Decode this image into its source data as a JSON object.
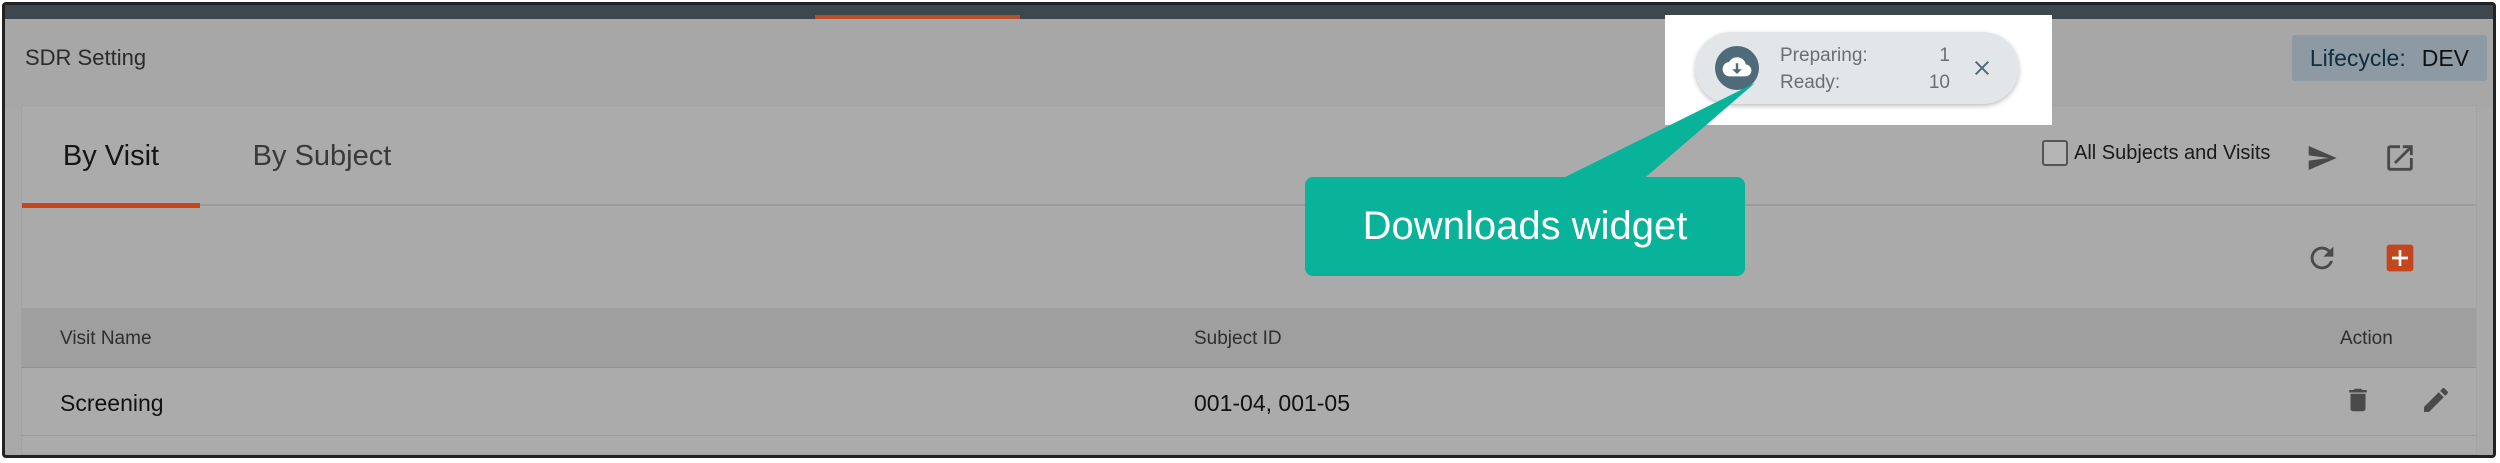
{
  "header": {
    "title": "SDR Setting",
    "lifecycle_label": "Lifecycle:",
    "lifecycle_value": "DEV"
  },
  "tabs": [
    {
      "label": "By Visit",
      "active": true
    },
    {
      "label": "By Subject",
      "active": false
    }
  ],
  "filters": {
    "all_subjects_label": "All Subjects and Visits",
    "all_subjects_checked": false
  },
  "table": {
    "columns": [
      "Visit Name",
      "Subject ID",
      "Action"
    ],
    "rows": [
      {
        "visit_name": "Screening",
        "subject_id": "001-04, 001-05"
      }
    ]
  },
  "downloads": {
    "preparing_label": "Preparing:",
    "preparing_count": "1",
    "ready_label": "Ready:",
    "ready_count": "10"
  },
  "callout": {
    "text": "Downloads widget"
  },
  "colors": {
    "accent": "#c4461f",
    "callout": "#09b39a",
    "add_button": "#c4461f",
    "cloud": "#4f6a79"
  },
  "icons": {
    "send": "send-icon",
    "open": "open-in-new-icon",
    "refresh": "refresh-icon",
    "add": "add-icon",
    "delete": "trash-icon",
    "edit": "pencil-icon",
    "download": "cloud-download-icon",
    "close": "close-icon"
  }
}
